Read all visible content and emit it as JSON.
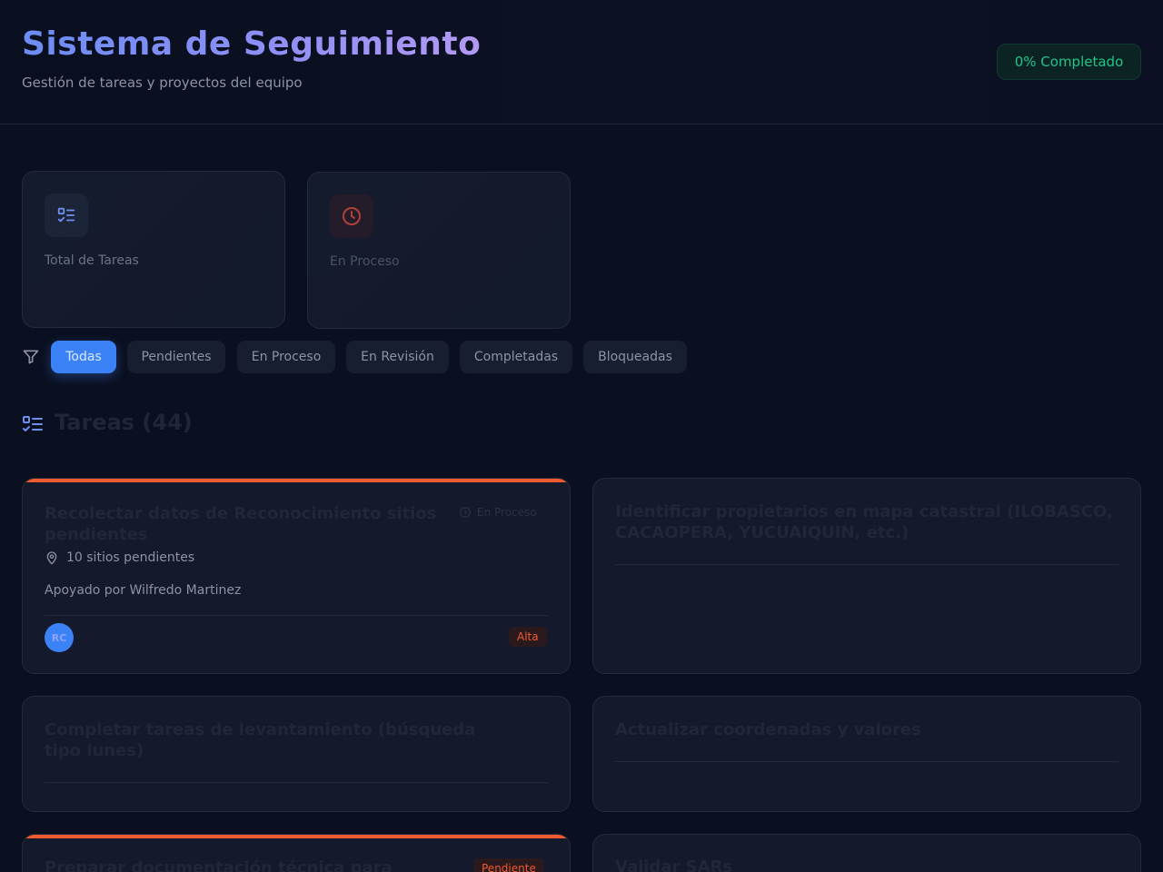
{
  "header": {
    "title": "Sistema de Seguimiento",
    "subtitle": "Gestión de tareas y proyectos del equipo",
    "progress_badge": "0% Completado"
  },
  "stats": [
    {
      "label": "Total de Tareas",
      "icon": "task-list-icon"
    },
    {
      "label": "En Proceso",
      "icon": "clock-icon"
    }
  ],
  "filters": {
    "icon": "filter-icon",
    "chips": [
      "Todas",
      "Pendientes",
      "En Proceso",
      "En Revisión",
      "Completadas",
      "Bloqueadas"
    ],
    "active": "Todas"
  },
  "tasks_section": {
    "title": "Tareas (44)"
  },
  "tasks": [
    {
      "title": "Recolectar datos de Reconocimiento sitios pendientes",
      "status": "En Proceso",
      "location": "10 sitios pendientes",
      "support": "Apoyado por Wilfredo Martinez",
      "assignee_initials": "RC",
      "priority": "Alta"
    },
    {
      "title": "Identificar propietarios en mapa catastral (ILOBASCO, CACAOPERA, YUCUAIQUIN, etc.)"
    },
    {
      "title": "Completar tareas de levantamiento (búsqueda tipo lunes)"
    },
    {
      "title": "Actualizar coordenadas y valores"
    },
    {
      "title": "Preparar documentación técnica para",
      "status": "Pendiente"
    },
    {
      "title": "Validar SARs"
    }
  ],
  "colors": {
    "accent": "#3b82f6",
    "success": "#22c58a",
    "priority_high": "#ef5a2f",
    "background": "#0b1020",
    "card": "#141a2b"
  }
}
